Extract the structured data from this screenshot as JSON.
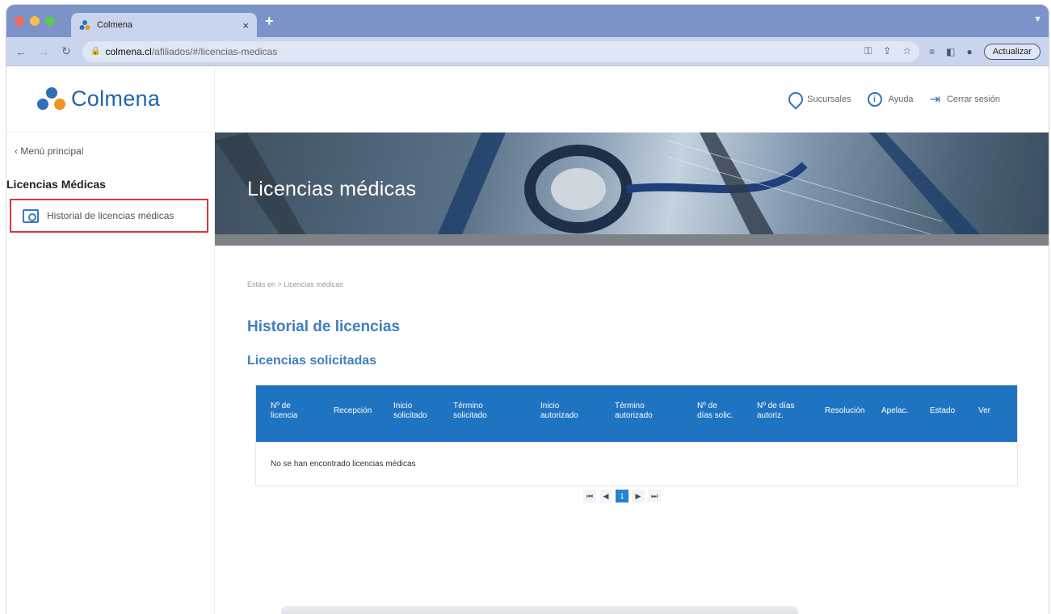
{
  "browser": {
    "tab_title": "Colmena",
    "tab_close": "×",
    "new_tab": "+",
    "url_host": "colmena.cl",
    "url_path": "/afiliados/#/licencias-medicas",
    "update_button": "Actualizar"
  },
  "site": {
    "logo_text": "Colmena",
    "brand_colors": {
      "primary": "#1f64ad",
      "accent": "#f29223",
      "table_header": "#1f74c2",
      "highlight_border": "#d9363e"
    }
  },
  "sidebar": {
    "back_link": "‹ Menú principal",
    "section_title": "Licencias Médicas",
    "items": [
      {
        "label": "Historial de licencias médicas",
        "icon": "folder-camera-icon",
        "highlighted": true
      }
    ]
  },
  "topnav": {
    "items": [
      {
        "label": "Sucursales",
        "icon": "location-pin-icon"
      },
      {
        "label": "Ayuda",
        "icon": "info-icon"
      },
      {
        "label": "Cerrar sesión",
        "icon": "logout-icon"
      }
    ]
  },
  "banner": {
    "title": "Licencias médicas"
  },
  "breadcrumb": "Estás en > Licencias médicas",
  "headings": {
    "history": "Historial de licencias",
    "requested": "Licencias solicitadas"
  },
  "table": {
    "columns": [
      "Nº de\nlicencia",
      "Recepción",
      "Inicio\nsolicitado",
      "Término\nsolicitado",
      "Inicio\nautorizado",
      "Término\nautorizado",
      "Nº de\ndías solic.",
      "Nº de días\nautoriz.",
      "Resolución",
      "Apelac.",
      "Estado",
      "Ver"
    ],
    "empty_message": "No se han encontrado licencias médicas"
  },
  "pagination": {
    "first": "⏮",
    "prev": "◀",
    "current_page": "1",
    "next": "▶",
    "last": "⏭"
  }
}
